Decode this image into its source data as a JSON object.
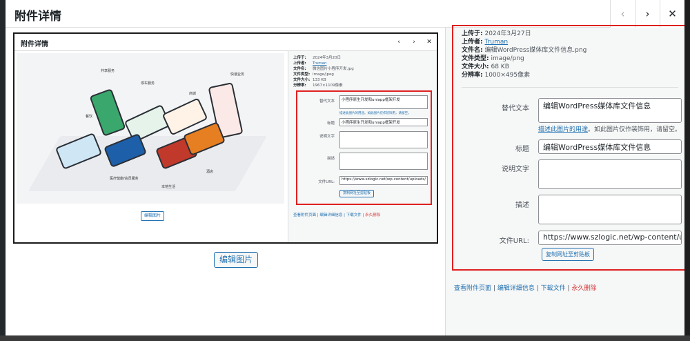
{
  "modal": {
    "title": "附件详情",
    "prev_icon": "‹",
    "next_icon": "›",
    "close_icon": "✕"
  },
  "inner": {
    "title": "附件详情",
    "meta": {
      "uploaded_on_label": "上传于:",
      "uploaded_on": "2024年3月20日",
      "uploaded_by_label": "上传者:",
      "uploaded_by": "Truman",
      "file_name_label": "文件名:",
      "file_name": "微信图片小程序开发.jpg",
      "file_type_label": "文件类型:",
      "file_type": "image/jpeg",
      "file_size_label": "文件大小:",
      "file_size": "133 KB",
      "dimensions_label": "分辨率:",
      "dimensions": "1967×1109像素"
    },
    "alt_label": "替代文本",
    "alt_value": "小程序原生开发和uniapp框架开发",
    "alt_help": "描述此图片的用途。如此图片仅作装饰用，请留空。",
    "title_label": "标题",
    "title_value": "小程序原生开发和uniapp框架开发",
    "caption_label": "说明文字",
    "desc_label": "描述",
    "url_label": "文件URL:",
    "url_value": "https://www.szlogic.net/wp-content/uploads/",
    "copy_button": "复制网址至剪贴板",
    "edit_image": "编辑图片",
    "actions": {
      "view": "查看附件页面",
      "edit": "编辑详细信息",
      "download": "下载文件",
      "delete": "永久删除"
    },
    "illustration_labels": [
      "共享服务",
      "停车服务",
      "商城",
      "快递业务",
      "餐饮",
      "医疗健康/会员服务",
      "本地生活",
      "酒店"
    ]
  },
  "edit_image_button": "编辑图片",
  "sidebar": {
    "uploaded_on_label": "上传于:",
    "uploaded_on": "2024年3月27日",
    "uploaded_by_label": "上传者:",
    "uploaded_by": "Truman",
    "file_name_label": "文件名:",
    "file_name": "编辑WordPress媒体库文件信息.png",
    "file_type_label": "文件类型:",
    "file_type": "image/png",
    "file_size_label": "文件大小:",
    "file_size": "68 KB",
    "dimensions_label": "分辨率:",
    "dimensions": "1000×495像素",
    "alt_label": "替代文本",
    "alt_value": "编辑WordPress媒体库文件信息",
    "alt_help_link": "描述此图片的用途",
    "alt_help_rest": "。如此图片仅作装饰用，请留空。",
    "title_label": "标题",
    "title_value": "编辑WordPress媒体库文件信息",
    "caption_label": "说明文字",
    "caption_value": "",
    "desc_label": "描述",
    "desc_value": "",
    "url_label": "文件URL:",
    "url_value": "https://www.szlogic.net/wp-content/uploads/",
    "copy_button": "复制网址至剪贴板",
    "actions": {
      "view": "查看附件页面",
      "sep": "|",
      "edit": "编辑详细信息",
      "download": "下载文件",
      "delete": "永久删除"
    }
  },
  "colors": {
    "accent": "#2271b1",
    "highlight_border": "#e02020",
    "delete": "#d63638"
  }
}
